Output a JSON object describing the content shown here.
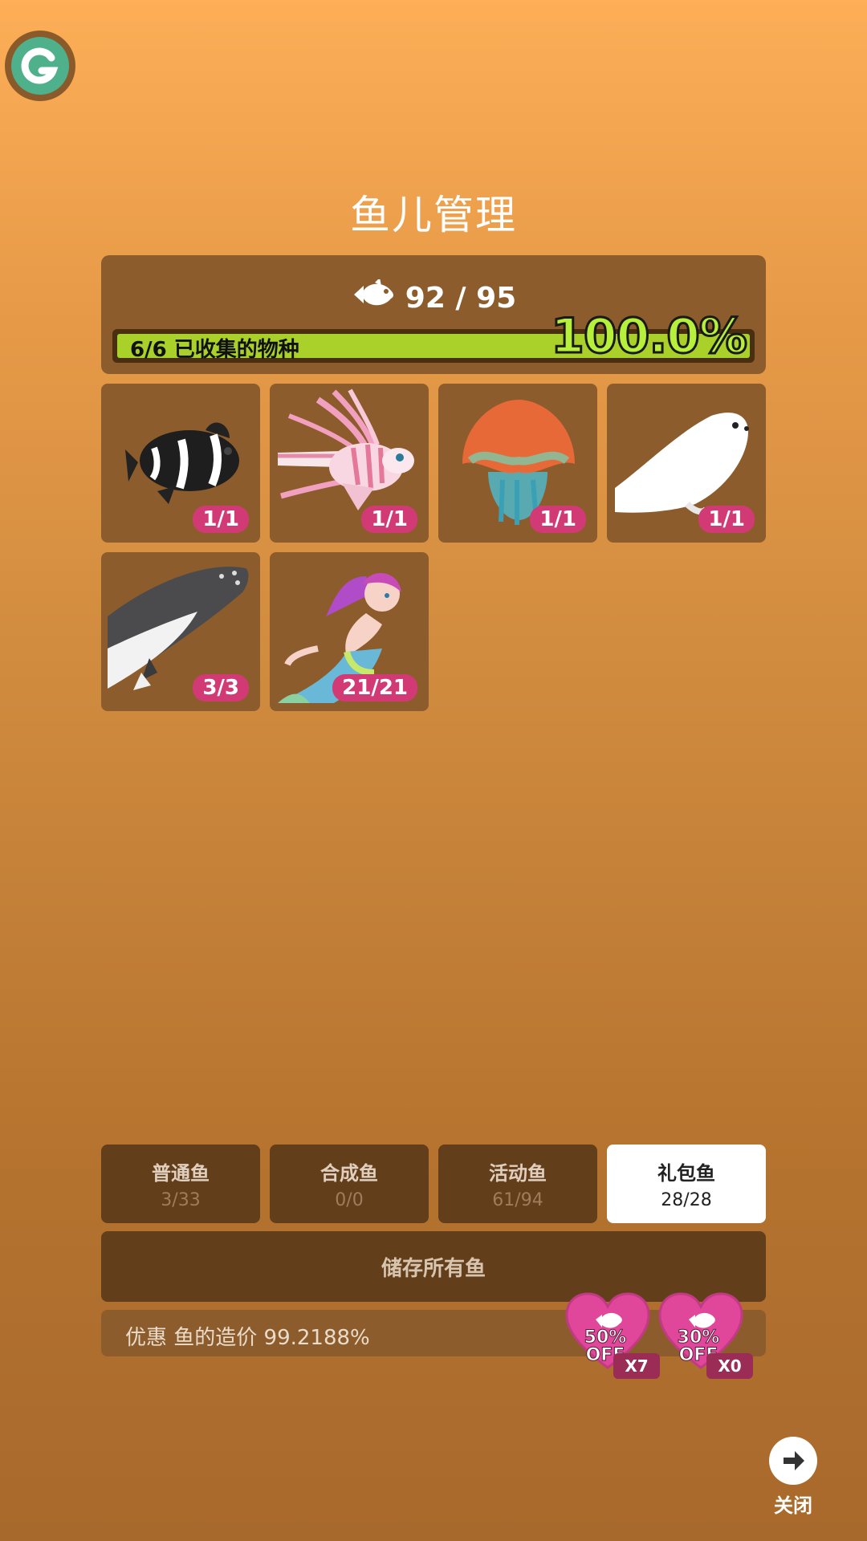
{
  "header": {
    "title": "鱼儿管理",
    "app_icon": "g-logo-icon"
  },
  "summary": {
    "fish_count": "92 / 95",
    "collected_label": "6/6 已收集的物种",
    "percent": "100.0%",
    "progress": 1.0
  },
  "species": [
    {
      "name": "clownfish",
      "count": "1/1"
    },
    {
      "name": "lionfish",
      "count": "1/1"
    },
    {
      "name": "jellyfish",
      "count": "1/1"
    },
    {
      "name": "seal",
      "count": "1/1"
    },
    {
      "name": "whale",
      "count": "3/3"
    },
    {
      "name": "mermaid",
      "count": "21/21"
    }
  ],
  "tabs": [
    {
      "name": "普通鱼",
      "count": "3/33"
    },
    {
      "name": "合成鱼",
      "count": "0/0"
    },
    {
      "name": "活动鱼",
      "count": "61/94"
    },
    {
      "name": "礼包鱼",
      "count": "28/28"
    }
  ],
  "store_button": "储存所有鱼",
  "discount": {
    "text": "优惠 鱼的造价 99.2188%",
    "coupons": [
      {
        "pct": "50%",
        "off": "OFF",
        "qty": "X7"
      },
      {
        "pct": "30%",
        "off": "OFF",
        "qty": "X0"
      }
    ]
  },
  "close": {
    "label": "关闭"
  },
  "colors": {
    "accent_green": "#a9d12a",
    "badge_pink": "#d23a75",
    "panel_brown": "#8d5c2c"
  }
}
